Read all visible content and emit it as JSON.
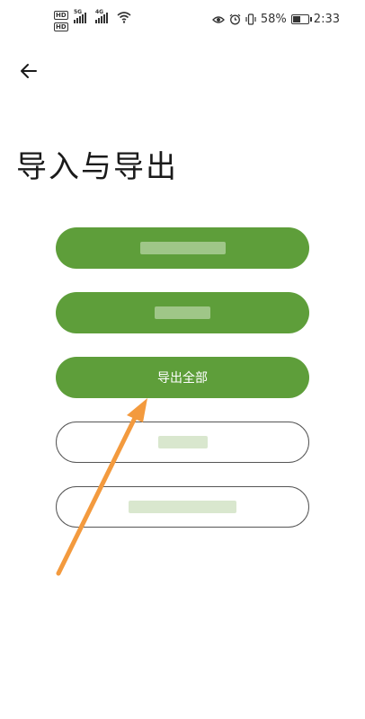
{
  "status_bar": {
    "hd_label": "HD",
    "net_label": "5G",
    "net_label_2": "4G",
    "battery_percent": "58%",
    "battery_level": 0.58,
    "time": "2:33"
  },
  "header": {
    "back_icon": "arrow-left-icon",
    "title": "导入与导出"
  },
  "buttons": [
    {
      "label": "",
      "style": "filled"
    },
    {
      "label": "",
      "style": "filled"
    },
    {
      "label": "导出全部",
      "style": "filled"
    },
    {
      "label": "",
      "style": "outline"
    },
    {
      "label": "",
      "style": "outline"
    }
  ],
  "colors": {
    "accent_green": "#5e9e3a",
    "annotation_arrow": "#f39a3e",
    "text": "#1a1a1a"
  }
}
